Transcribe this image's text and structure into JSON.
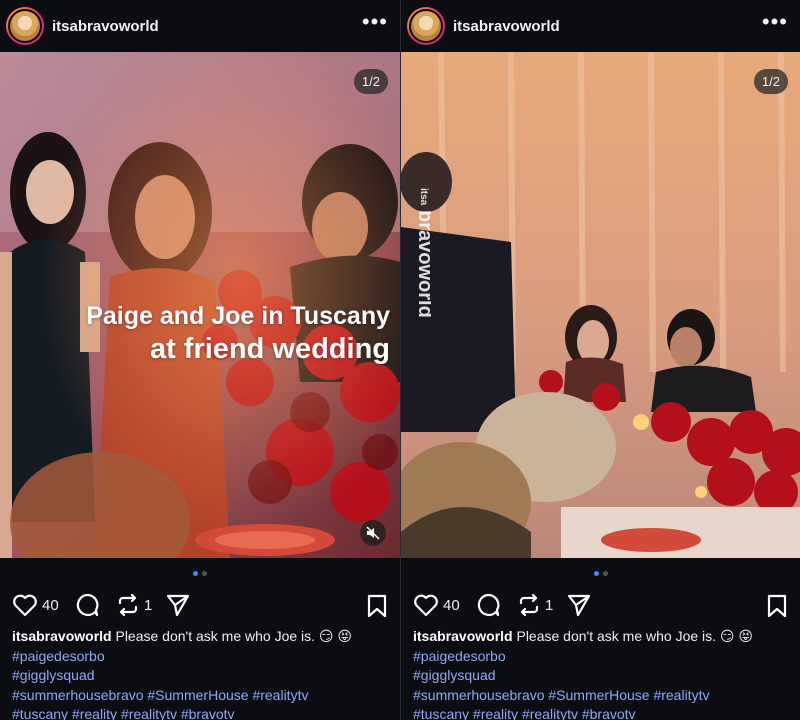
{
  "posts": [
    {
      "username": "itsabravoworld",
      "slide_counter": "1/2",
      "overlay_line1": "Paige and Joe in Tuscany",
      "overlay_line2": "at friend wedding",
      "likes": "40",
      "reposts": "1",
      "caption_text": "Please don't ask me who Joe is. 😏 😝",
      "hashtags": {
        "line1": "#paigedesorbo",
        "line2": "#gigglysquad",
        "line3": "#summerhousebravo #SummerHouse #realitytv",
        "line4": "#tuscany #reality #realitytv #bravotv"
      }
    },
    {
      "username": "itsabravoworld",
      "slide_counter": "1/2",
      "watermark_small": "itsa",
      "watermark_big": "bravoworld",
      "likes": "40",
      "reposts": "1",
      "caption_text": "Please don't ask me who Joe is. 😏 😝",
      "hashtags": {
        "line1": "#paigedesorbo",
        "line2": "#gigglysquad",
        "line3": "#summerhousebravo #SummerHouse #realitytv",
        "line4": "#tuscany #reality #realitytv #bravotv"
      }
    }
  ],
  "carousel": {
    "total_slides": 2,
    "active_slide": 1
  },
  "icons": [
    "more-icon",
    "heart-icon",
    "comment-icon",
    "repost-icon",
    "share-icon",
    "bookmark-icon",
    "mute-icon"
  ],
  "colors": {
    "background": "#0b0d12",
    "hashtag": "#8fa9f5",
    "active_dot": "#3d8bff"
  }
}
